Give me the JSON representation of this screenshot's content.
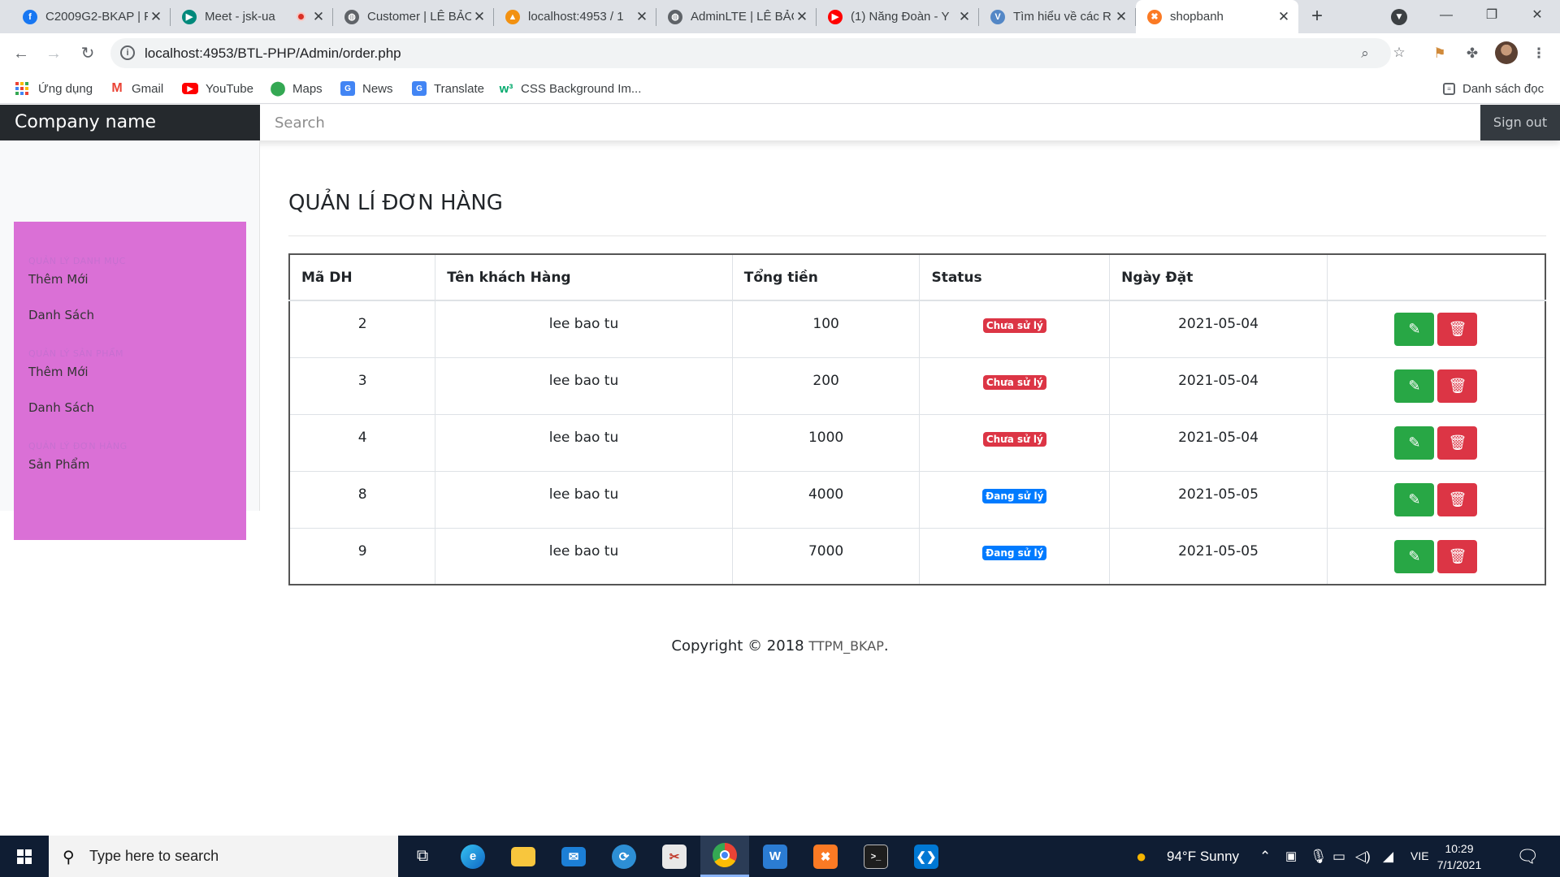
{
  "browser": {
    "tabs": [
      {
        "title": "C2009G2-BKAP | F",
        "icon": "facebook-icon",
        "color": "#1877f2"
      },
      {
        "title": "Meet - jsk-ua",
        "icon": "google-meet-icon",
        "color": "#00897b",
        "recording": true
      },
      {
        "title": "Customer | LÊ BẢO",
        "icon": "globe-icon",
        "color": "#5f6368"
      },
      {
        "title": "localhost:4953 / 1",
        "icon": "phpmyadmin-icon",
        "color": "#f29111"
      },
      {
        "title": "AdminLTE | LÊ BẢO",
        "icon": "globe-icon",
        "color": "#5f6368"
      },
      {
        "title": "(1) Năng Đoàn - Y",
        "icon": "youtube-icon",
        "color": "#ff0000"
      },
      {
        "title": "Tìm hiểu về các R",
        "icon": "viblo-icon",
        "color": "#5387c6"
      },
      {
        "title": "shopbanh",
        "icon": "xampp-icon",
        "color": "#fb7a24",
        "active": true
      }
    ],
    "url": "localhost:4953/BTL-PHP/Admin/order.php",
    "bookmarks": [
      {
        "label": "Ứng dụng",
        "icon": "apps-grid-icon"
      },
      {
        "label": "Gmail",
        "icon": "gmail-icon"
      },
      {
        "label": "YouTube",
        "icon": "youtube-icon"
      },
      {
        "label": "Maps",
        "icon": "maps-pin-icon"
      },
      {
        "label": "News",
        "icon": "google-news-icon"
      },
      {
        "label": "Translate",
        "icon": "google-translate-icon"
      },
      {
        "label": "CSS Background Im...",
        "icon": "w3schools-icon"
      }
    ],
    "reading_list": "Danh sách đọc"
  },
  "app": {
    "brand": "Company name",
    "search_placeholder": "Search",
    "sign_out": "Sign out",
    "accent_color": "#da70d6",
    "sidebar": [
      {
        "heading": "QUẢN LÝ DANH MỤC",
        "items": [
          "Thêm Mới",
          "Danh Sách"
        ]
      },
      {
        "heading": "QUẢN LÝ SẢN PHẨM",
        "items": [
          "Thêm Mới",
          "Danh Sách"
        ]
      },
      {
        "heading": "QUẢN LÝ ĐƠN HÀNG",
        "items": [
          "Sản Phẩm"
        ]
      }
    ],
    "page_title": "QUẢN LÍ ĐƠN HÀNG",
    "table": {
      "columns": [
        "Mã DH",
        "Tên khách Hàng",
        "Tổng tiền",
        "Status",
        "Ngày Đặt",
        ""
      ],
      "rows": [
        {
          "id": "2",
          "customer": "lee bao tu",
          "total": "100",
          "status": "Chưa sử lý",
          "status_type": "danger",
          "date": "2021-05-04"
        },
        {
          "id": "3",
          "customer": "lee bao tu",
          "total": "200",
          "status": "Chưa sử lý",
          "status_type": "danger",
          "date": "2021-05-04"
        },
        {
          "id": "4",
          "customer": "lee bao tu",
          "total": "1000",
          "status": "Chưa sử lý",
          "status_type": "danger",
          "date": "2021-05-04"
        },
        {
          "id": "8",
          "customer": "lee bao tu",
          "total": "4000",
          "status": "Đang sử lý",
          "status_type": "primary",
          "date": "2021-05-05"
        },
        {
          "id": "9",
          "customer": "lee bao tu",
          "total": "7000",
          "status": "Đang sử lý",
          "status_type": "primary",
          "date": "2021-05-05"
        }
      ]
    },
    "footer": {
      "text": "Copyright © 2018 ",
      "company": "TTPM_BKAP",
      "suffix": "."
    }
  },
  "taskbar": {
    "search_placeholder": "Type here to search",
    "weather": "94°F  Sunny",
    "language": "VIE",
    "time": "10:29",
    "date": "7/1/2021"
  }
}
